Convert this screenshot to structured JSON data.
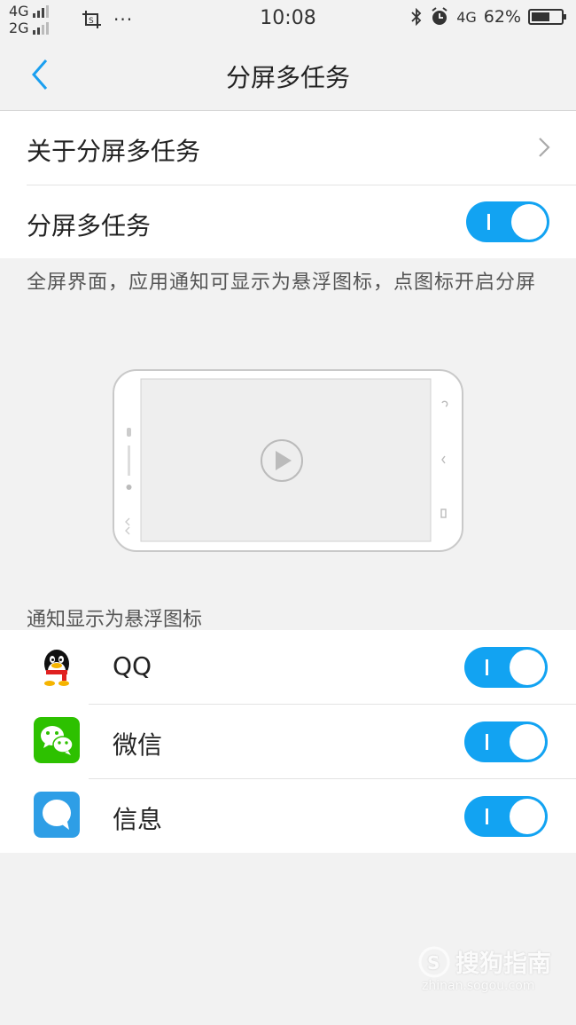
{
  "status_bar": {
    "net1": "4G",
    "net2": "2G",
    "dots": "···",
    "time": "10:08",
    "net_right": "4G",
    "battery": "62%",
    "battery_level": 0.62
  },
  "nav": {
    "title": "分屏多任务"
  },
  "settings": {
    "about_label": "关于分屏多任务",
    "multitask_label": "分屏多任务",
    "multitask_on": true,
    "description": "全屏界面，应用通知可显示为悬浮图标，点图标开启分屏"
  },
  "notify_section": {
    "header": "通知显示为悬浮图标",
    "apps": [
      {
        "name": "QQ",
        "icon": "qq-icon",
        "on": true
      },
      {
        "name": "微信",
        "icon": "wechat-icon",
        "on": true
      },
      {
        "name": "信息",
        "icon": "messages-icon",
        "on": true
      }
    ]
  },
  "colors": {
    "accent": "#12a3f2",
    "back_arrow": "#1a9ff0",
    "wechat": "#2dc100",
    "messages": "#2e9ee6"
  },
  "watermark": {
    "main": "搜狗指南",
    "sub": "zhinan.sogou.com"
  }
}
